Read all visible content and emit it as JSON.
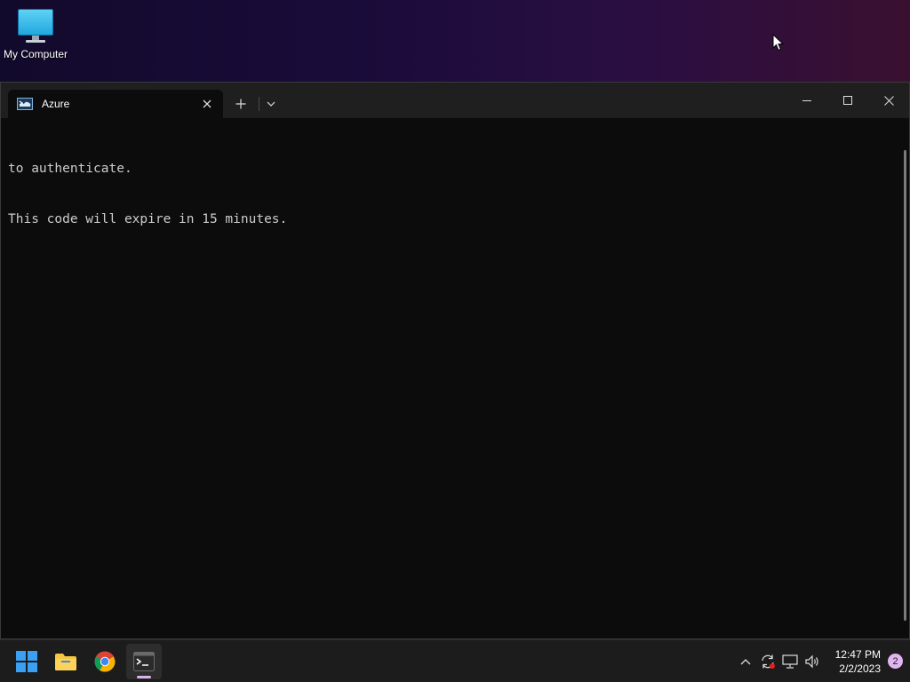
{
  "desktop": {
    "icons": [
      {
        "label": "My Computer",
        "icon": "computer-icon"
      }
    ]
  },
  "window": {
    "tab": {
      "title": "Azure",
      "icon": "azure-cloud-shell-icon"
    },
    "controls": [
      "minimize",
      "maximize",
      "close"
    ],
    "terminal_lines": [
      "to authenticate.",
      "This code will expire in 15 minutes."
    ]
  },
  "taskbar": {
    "apps": [
      {
        "name": "Start",
        "icon": "windows-start-icon"
      },
      {
        "name": "File Explorer",
        "icon": "folder-icon"
      },
      {
        "name": "Google Chrome",
        "icon": "chrome-icon"
      },
      {
        "name": "Terminal",
        "icon": "terminal-icon",
        "active": true
      }
    ],
    "tray": {
      "icons": [
        "chevron-up-icon",
        "sync-icon",
        "network-icon",
        "volume-icon"
      ],
      "time": "12:47 PM",
      "date": "2/2/2023",
      "notification_count": "2"
    }
  },
  "colors": {
    "terminal_bg": "#0c0c0c",
    "titlebar_bg": "#1f1f1f",
    "taskbar_bg": "#1c1c1c",
    "accent": "#d8b4e8"
  }
}
